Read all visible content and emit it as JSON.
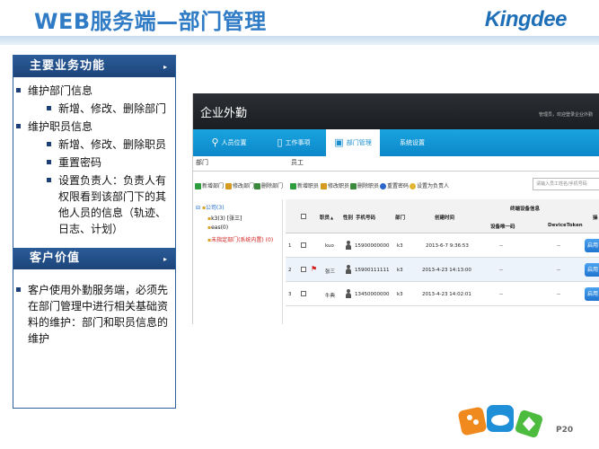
{
  "slide": {
    "title": "WEB服务端—部门管理",
    "brand": "Kingdee",
    "page_number": "P20"
  },
  "left_panel": {
    "section1": {
      "header": "主要业务功能",
      "arrow": "▸",
      "items": [
        {
          "text": "维护部门信息"
        },
        {
          "text": "新增、修改、删除部门"
        },
        {
          "text": "维护职员信息"
        },
        {
          "text": "新增、修改、删除职员"
        },
        {
          "text": "重置密码"
        },
        {
          "text": "设置负责人：负责人有权限看到该部门下的其他人员的信息（轨迹、日志、计划）"
        }
      ]
    },
    "section2": {
      "header": "客户价值",
      "arrow": "▸",
      "items": [
        {
          "text": "客户使用外勤服务端，必须先在部门管理中进行相关基础资料的维护：部门和职员信息的维护"
        }
      ]
    }
  },
  "app": {
    "name": "企业外勤",
    "user_info": "管理员，欢迎登录企业外勤",
    "nav": [
      {
        "label": "人员位置",
        "icon": "location-pin-icon"
      },
      {
        "label": "工作事项",
        "icon": "document-icon"
      },
      {
        "label": "部门管理",
        "icon": "department-icon"
      },
      {
        "label": "系统设置",
        "icon": "gear-icon"
      }
    ],
    "dept_label": "部门",
    "staff_label": "员工",
    "dept_toolbar": {
      "add": "新增部门",
      "edit": "修改部门",
      "delete": "删除部门"
    },
    "staff_toolbar": {
      "add": "新增职员",
      "edit": "修改职员",
      "delete": "删除职员",
      "reset": "重置密码",
      "set_leader": "设置为负责人"
    },
    "search_placeholder": "请输入员工姓名/手机号码",
    "tree": {
      "root": "公司(3)",
      "children": [
        "k3(3) [张三]",
        "eas(0)",
        "未指定部门(系统内置) (0)"
      ]
    },
    "grid": {
      "headers": {
        "name": "职员",
        "sort": "▲",
        "gender": "性别",
        "phone": "手机号码",
        "dept": "部门",
        "created": "创建时间",
        "binding": "终端设备信息",
        "device_id": "设备唯一码",
        "device_token": "DeviceToken",
        "ops": "操"
      },
      "rows": [
        {
          "index": "1",
          "name": "kuo",
          "phone": "15900000000",
          "dept": "k3",
          "created": "2013-6-7 9:36:53",
          "device_id": "--",
          "device_token": "--",
          "action": "启用"
        },
        {
          "index": "2",
          "name": "张三",
          "phone": "15900111111",
          "dept": "k3",
          "created": "2013-4-23 14:13:00",
          "device_id": "--",
          "device_token": "--",
          "action": "启用"
        },
        {
          "index": "3",
          "name": "牛典",
          "phone": "13450000000",
          "dept": "k3",
          "created": "2013-4-23 14:02:01",
          "device_id": "--",
          "device_token": "--",
          "action": "启用"
        }
      ]
    }
  },
  "colors": {
    "title_blue": "#2f7bc5",
    "panel_navy": "#1c4479",
    "nav_cyan": "#0c88c9",
    "enable_button": "#1f74cf"
  }
}
